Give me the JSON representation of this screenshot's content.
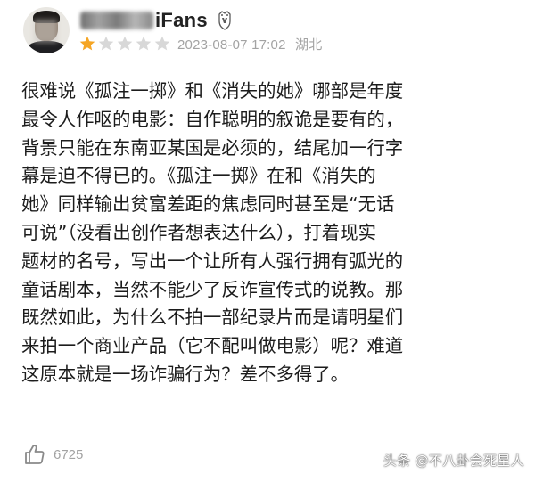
{
  "review": {
    "user": {
      "name_visible": "iFans",
      "badge_icon": "vip-badge-icon"
    },
    "rating": {
      "stars_filled": 1,
      "stars_total": 5,
      "star_color": "#f5a524",
      "empty_star_color": "#d8d8d8"
    },
    "date": "2023-08-07 17:02",
    "location": "湖北",
    "body_lines": [
      "很难说《孤注一掷》和《消失的她》哪部是年度",
      "最令人作呕的电影：自作聪明的叙诡是要有的，",
      "背景只能在东南亚某国是必须的，结尾加一行字",
      "幕是迫不得已的。《孤注一掷》在和《消失的",
      "她》同样输出贫富差距的焦虑同时甚至是“无话",
      "可说”（没看出创作者想表达什么），打着现实",
      "题材的名号，写出一个让所有人强行拥有弧光的",
      "童话剧本，当然不能少了反诈宣传式的说教。那",
      "既然如此，为什么不拍一部纪录片而是请明星们",
      "来拍一个商业产品（它不配叫做电影）呢？难道",
      "这原本就是一场诈骗行为？差不多得了。"
    ],
    "likes": "6725"
  },
  "watermark": "头条 @不八卦会死星人",
  "colors": {
    "meta_text": "#a3a3a3",
    "body_text": "#1c1c1c",
    "background": "#ffffff"
  }
}
